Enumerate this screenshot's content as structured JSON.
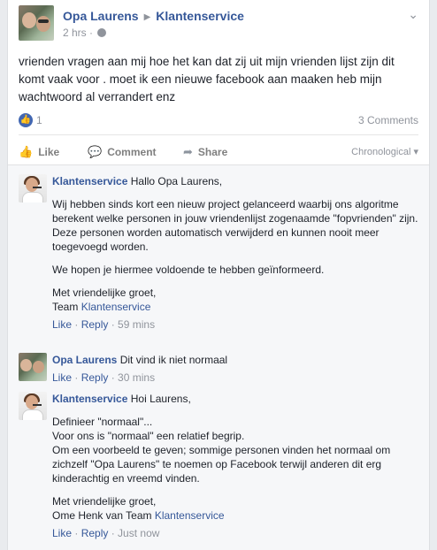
{
  "post": {
    "author": "Opa Laurens",
    "target": "Klantenservice",
    "time": "2 hrs",
    "text": "vrienden vragen aan mij hoe het kan dat zij uit mijn vrienden lijst zijn dit komt vaak voor . moet ik een nieuwe facebook aan maaken heb mijn wachtwoord al verrandert enz",
    "like_count": "1",
    "comments_count": "3 Comments"
  },
  "actions": {
    "like": "Like",
    "comment": "Comment",
    "share": "Share",
    "sort": "Chronological ▾"
  },
  "comments": [
    {
      "author": "Klantenservice",
      "greeting": "Hallo Opa Laurens,",
      "p1": "Wij hebben sinds kort een nieuw project gelanceerd waarbij ons algoritme berekent welke personen in jouw vriendenlijst zogenaamde \"fopvrienden\" zijn.",
      "p1b": "Deze personen worden automatisch verwijderd en kunnen nooit meer toegevoegd worden.",
      "p2": "We hopen je hiermee voldoende te hebben geïnformeerd.",
      "sign1": "Met vriendelijke groet,",
      "sign2_prefix": "Team ",
      "sign2_link": "Klantenservice",
      "like": "Like",
      "reply": "Reply",
      "time": "59 mins"
    },
    {
      "author": "Opa Laurens",
      "text": "Dit vind ik niet normaal",
      "like": "Like",
      "reply": "Reply",
      "time": "30 mins"
    },
    {
      "author": "Klantenservice",
      "greeting": "Hoi Laurens,",
      "l1": "Definieer \"normaal\"...",
      "l2": "Voor ons is \"normaal\" een relatief begrip.",
      "l3": "Om een voorbeeld te geven; sommige personen vinden het normaal om zichzelf \"Opa Laurens\" te noemen op Facebook terwijl anderen dit erg kinderachtig en vreemd vinden.",
      "sign1": "Met vriendelijke groet,",
      "sign2_prefix": "Ome Henk van Team ",
      "sign2_link": "Klantenservice",
      "like": "Like",
      "reply": "Reply",
      "time": "Just now"
    }
  ],
  "colors": {
    "link": "#365899",
    "muted": "#90949c",
    "like_badge": "#4267b2"
  },
  "icons": [
    "globe-icon",
    "chevron-down-icon",
    "like-badge-icon",
    "thumbs-up-icon",
    "comment-icon",
    "share-icon"
  ]
}
